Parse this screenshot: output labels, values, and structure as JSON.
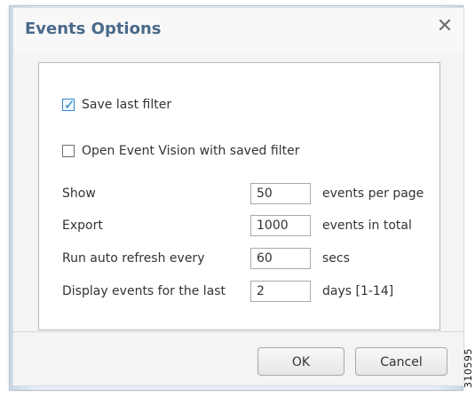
{
  "dialog": {
    "title": "Events Options",
    "close_glyph": "✕"
  },
  "options": {
    "save_last_filter": {
      "label": "Save last filter",
      "checked": true
    },
    "open_event_vision": {
      "label": "Open Event Vision with saved filter",
      "checked": false
    }
  },
  "fields": [
    {
      "label": "Show",
      "value": "50",
      "unit": "events per page"
    },
    {
      "label": "Export",
      "value": "1000",
      "unit": "events in total"
    },
    {
      "label": "Run auto refresh every",
      "value": "60",
      "unit": "secs"
    },
    {
      "label": "Display events for the last",
      "value": "2",
      "unit": "days [1-14]"
    }
  ],
  "buttons": {
    "ok": "OK",
    "cancel": "Cancel"
  },
  "side_code": "310595",
  "icons": {
    "close": "close-icon",
    "checkmark": "check-icon"
  },
  "colors": {
    "title": "#4a6a8a",
    "accent": "#1f7fc4"
  }
}
